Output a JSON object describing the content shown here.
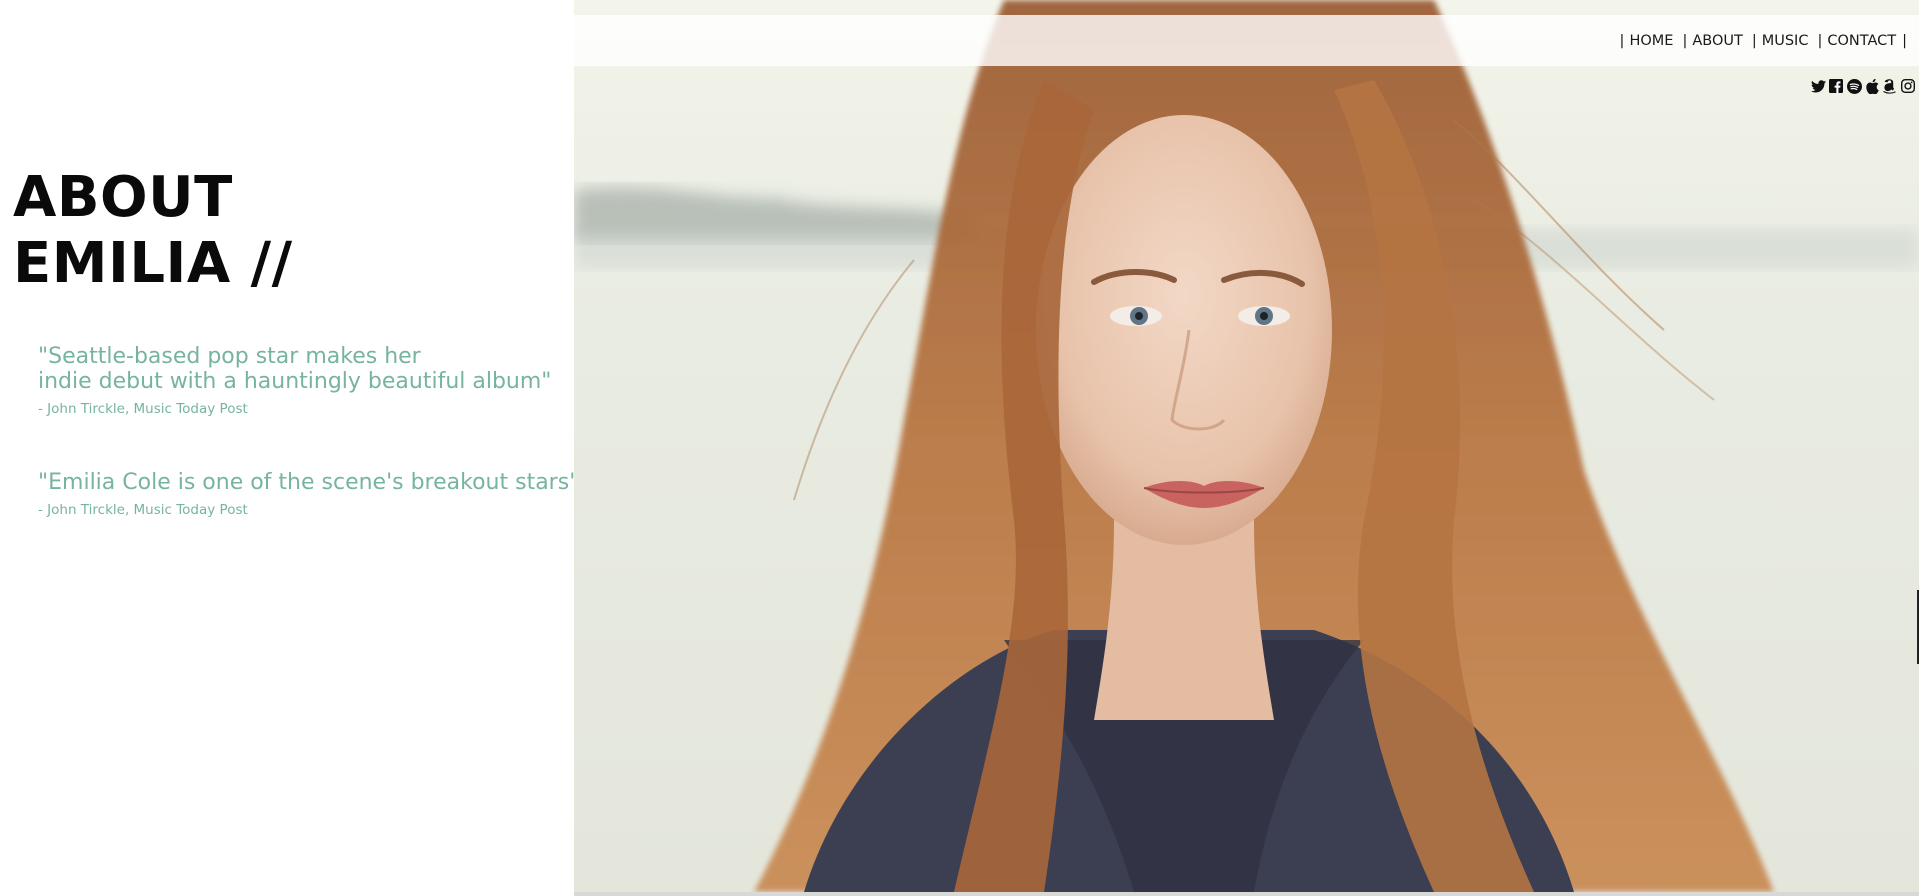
{
  "nav": {
    "items": [
      {
        "label": "HOME"
      },
      {
        "label": "ABOUT"
      },
      {
        "label": "MUSIC"
      },
      {
        "label": "CONTACT"
      }
    ],
    "separator": "|"
  },
  "social": {
    "icons": [
      "twitter-icon",
      "facebook-icon",
      "spotify-icon",
      "apple-icon",
      "amazon-icon",
      "instagram-icon"
    ]
  },
  "about": {
    "title_line1": "ABOUT",
    "title_line2": "EMILIA //"
  },
  "quotes": [
    {
      "line1": "\"Seattle-based pop star makes her",
      "line2": "indie debut with a hauntingly beautiful album\"",
      "source": "- John Tirckle, Music Today Post"
    },
    {
      "line1": "\"Emilia Cole is one of the scene's breakout stars\"",
      "source": "- John Tirckle, Music Today Post"
    }
  ],
  "colors": {
    "quote_accent": "#76b4a0",
    "title": "#0a0a0a",
    "nav_text": "#1a1a1a"
  }
}
